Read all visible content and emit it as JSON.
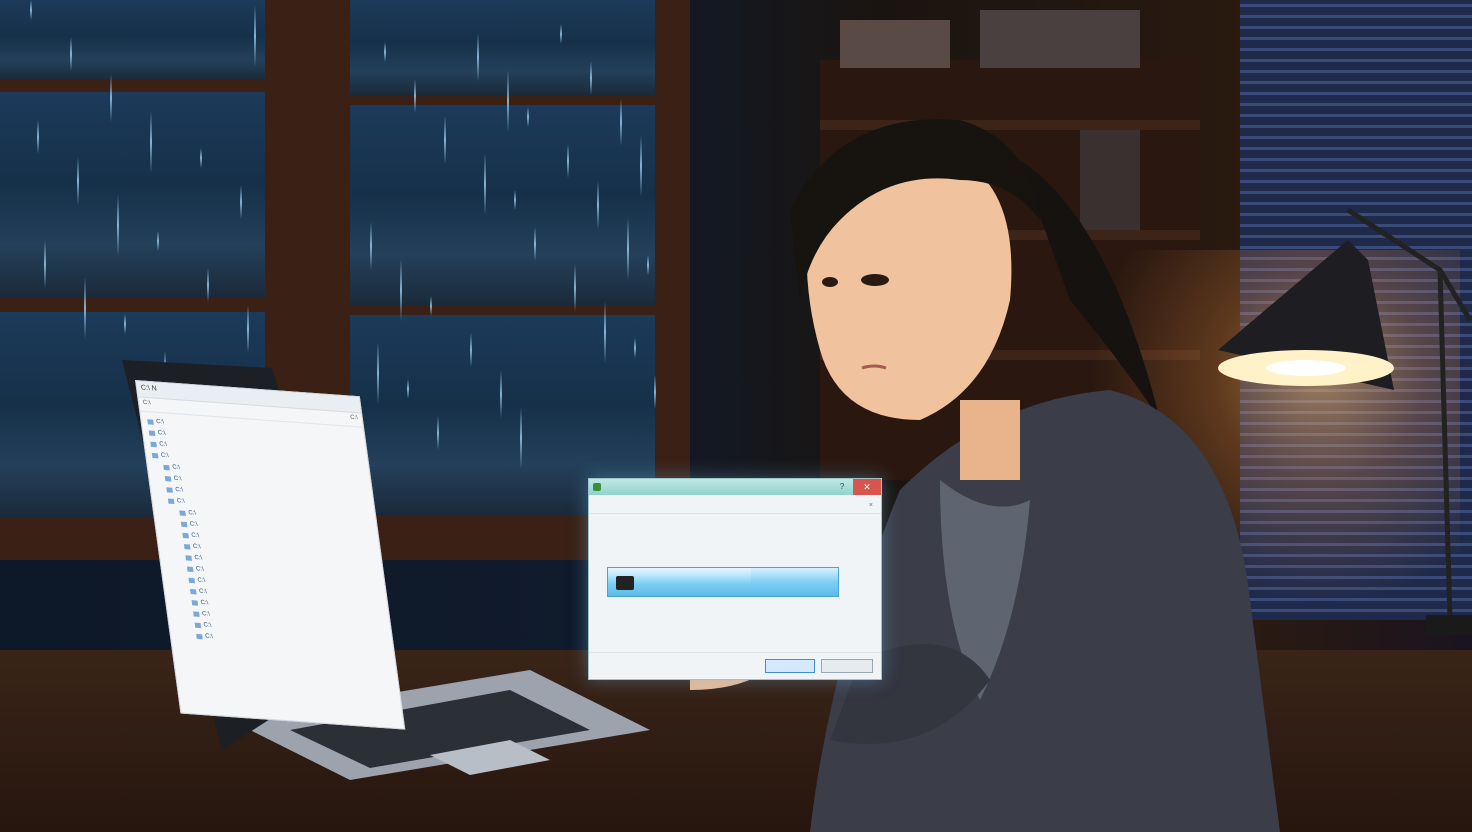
{
  "laptop": {
    "window_title": "C:\\ N",
    "address_left": "C:\\",
    "address_right": "C:\\",
    "tree_items": [
      "C:\\",
      "C:\\",
      "C:\\",
      "C:\\",
      "C:\\",
      "C:\\",
      "C:\\",
      "C:\\",
      "C:\\",
      "C:\\",
      "C:\\",
      "C:\\",
      "C:\\",
      "C:\\",
      "C:\\",
      "C:\\",
      "C:\\",
      "C:\\",
      "C:\\",
      "C:\\"
    ]
  },
  "dialog": {
    "title": "",
    "help_glyph": "?",
    "close_glyph": "✕",
    "menu": [
      "",
      "",
      "",
      "",
      ""
    ],
    "menu_close": "×",
    "heading": "",
    "subheading": "",
    "count": "",
    "section_label": "",
    "progress_text": "",
    "progress_fraction": 0.62,
    "primary_button": "",
    "secondary_button": ""
  },
  "colors": {
    "accent": "#5bbbe8",
    "close": "#d9534f",
    "titlebar": "#8fd3cb"
  }
}
